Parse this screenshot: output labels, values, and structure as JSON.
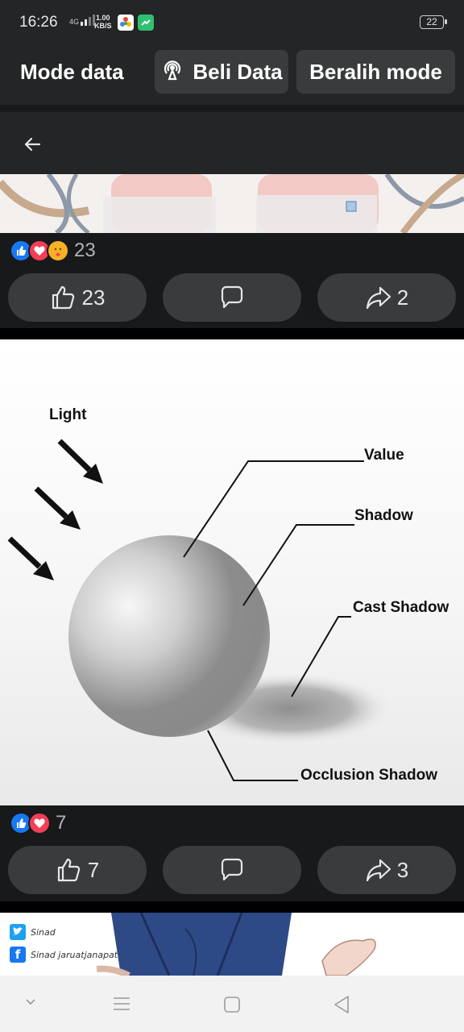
{
  "status_bar": {
    "time": "16:26",
    "network": "4G",
    "speed_value": "1.00",
    "speed_unit": "KB/S",
    "battery": "22"
  },
  "data_banner": {
    "title": "Mode data",
    "buy_data_label": "Beli Data",
    "switch_mode_label": "Beralih mode"
  },
  "post1": {
    "reaction_count": "23",
    "like_count": "23",
    "share_count": "2"
  },
  "post2": {
    "image_labels": {
      "light": "Light",
      "value": "Value",
      "shadow": "Shadow",
      "cast_shadow": "Cast Shadow",
      "occlusion_shadow": "Occlusion Shadow"
    },
    "reaction_count": "7",
    "like_count": "7",
    "share_count": "3"
  },
  "post3": {
    "twitter_handle": "Sinad",
    "facebook_handle": "Sinad jaruatjanapat"
  },
  "colors": {
    "background": "#18191a",
    "surface": "#242526",
    "button": "#3a3b3c",
    "like_blue": "#1877f2",
    "love_red": "#f33e58"
  }
}
